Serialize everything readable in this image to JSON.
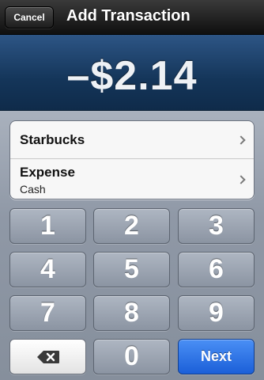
{
  "navbar": {
    "cancel_label": "Cancel",
    "title": "Add Transaction"
  },
  "amount": {
    "display": "–$2.14"
  },
  "details": {
    "payee": "Starbucks",
    "category": "Expense",
    "account": "Cash"
  },
  "keypad": {
    "digits": [
      "1",
      "2",
      "3",
      "4",
      "5",
      "6",
      "7",
      "8",
      "9",
      "0"
    ],
    "backspace_icon": "backspace-icon",
    "next_label": "Next",
    "next_color": "#1f66e0"
  },
  "colors": {
    "amount_bg": "#143559",
    "nav_bg": "#1d1d1d",
    "key_bg": "#9aa3b0"
  }
}
